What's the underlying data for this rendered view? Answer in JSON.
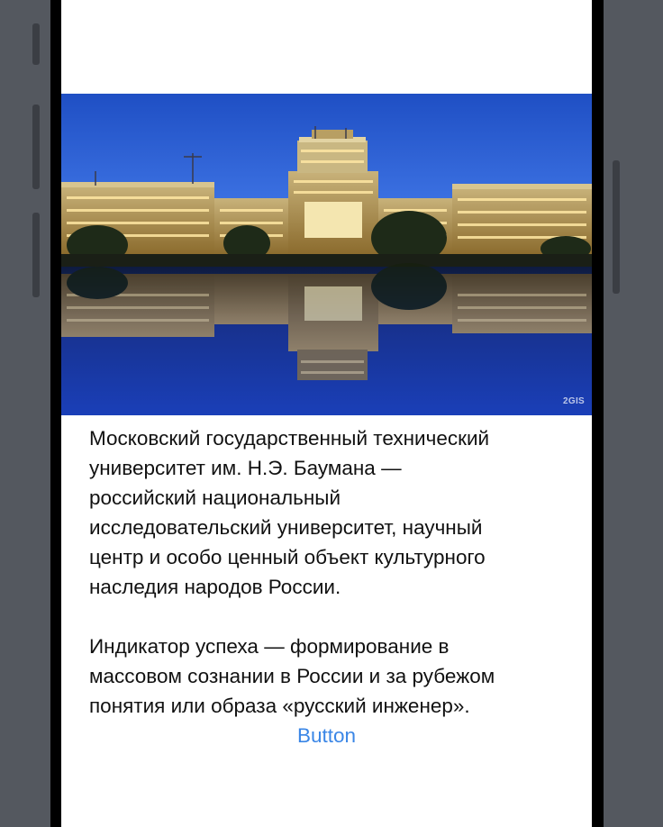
{
  "content": {
    "image_alt": "Главное здание МГТУ им. Н.Э. Баумана ночью с отражением в воде",
    "image_credit": "2GIS",
    "description": "Московский государственный технический\nуниверситет им. Н.Э. Баумана —\nроссийский национальный\nисследовательский университет, научный\nцентр и особо ценный объект культурного\nнаследия народов России.\n\nИндикатор успеха — формирование в\nмассовом сознании в России и за рубежом\nпонятия или образа «русский инженер».",
    "button_label": "Button"
  },
  "colors": {
    "background": "#ffffff",
    "text": "#111111",
    "button": "#3a86e6",
    "device_frame": "#54585f"
  }
}
